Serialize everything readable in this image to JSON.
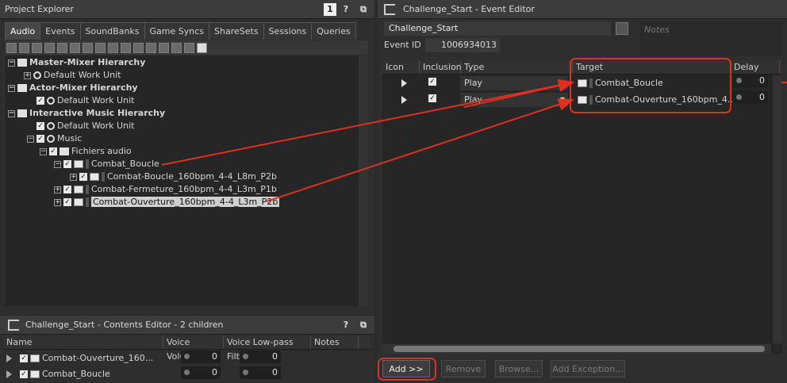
{
  "project_explorer": {
    "title": "Project Explorer",
    "tabs": [
      "Audio",
      "Events",
      "SoundBanks",
      "Game Syncs",
      "ShareSets",
      "Sessions",
      "Queries"
    ],
    "tree": {
      "master_mixer": "Master-Mixer Hierarchy",
      "master_wu": "Default Work Unit",
      "actor_mixer": "Actor-Mixer Hierarchy",
      "actor_wu": "Default Work Unit",
      "interactive": "Interactive Music Hierarchy",
      "interactive_wu": "Default Work Unit",
      "music": "Music",
      "fichiers": "Fichiers audio",
      "combat_boucle": "Combat_Boucle",
      "combat_boucle_child": "Combat-Boucle_160bpm_4-4_L8m_P2b",
      "combat_fermeture": "Combat-Fermeture_160bpm_4-4_L3m_P1b",
      "combat_ouverture": "Combat-Ouverture_160bpm_4-4_L3m_P2b"
    }
  },
  "contents_editor": {
    "title": "Challenge_Start - Contents Editor - 2 children",
    "columns": [
      "Name",
      "Voice Volume",
      "Voice Low-pass Filter",
      "Notes"
    ],
    "rows": [
      {
        "name": "Combat-Ouverture_160...",
        "volume": "0",
        "lpf": "0"
      },
      {
        "name": "Combat_Boucle",
        "volume": "0",
        "lpf": "0"
      }
    ]
  },
  "event_editor": {
    "title": "Challenge_Start - Event Editor",
    "name_value": "Challenge_Start",
    "notes_placeholder": "Notes",
    "event_id_label": "Event ID",
    "event_id_value": "1006934013",
    "columns": [
      "Icon",
      "Inclusion",
      "Type",
      "Target",
      "Delay"
    ],
    "actions": [
      {
        "type": "Play",
        "target": "Combat_Boucle",
        "delay": "0"
      },
      {
        "type": "Play",
        "target": "Combat-Ouverture_160bpm_4...",
        "delay": "0"
      }
    ],
    "buttons": {
      "add": "Add >>",
      "remove": "Remove",
      "browse": "Browse...",
      "add_exception": "Add Exception..."
    }
  },
  "colors": {
    "annotation": "#e03020",
    "background": "#2b2b2b"
  }
}
